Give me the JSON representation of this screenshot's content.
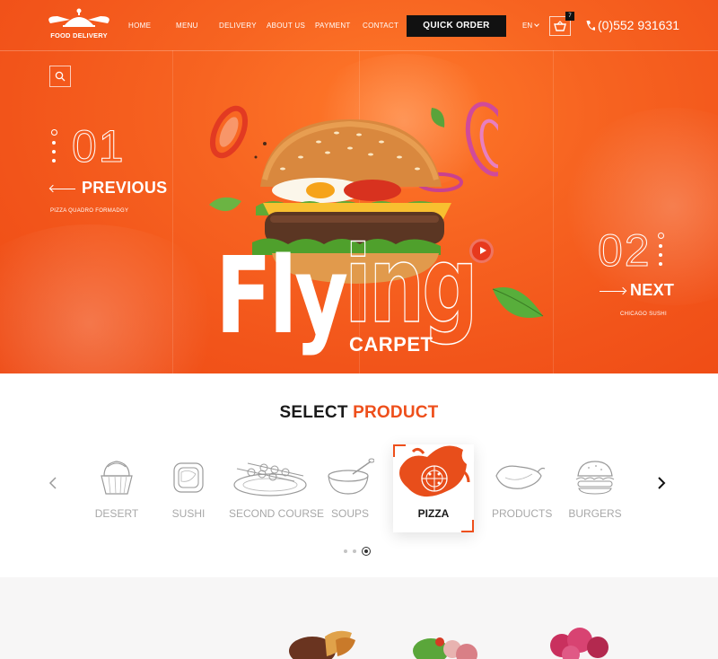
{
  "brand": {
    "name": "FOOD DELIVERY"
  },
  "nav": {
    "items": [
      "HOME",
      "MENU",
      "DELIVERY",
      "ABOUT US",
      "PAYMENT",
      "CONTACT"
    ],
    "quick_order": "QUICK ORDER",
    "language": "EN",
    "cart_count": "7",
    "phone": "(0)552 931631"
  },
  "hero": {
    "prev_number": "01",
    "prev_label": "PREVIOUS",
    "prev_caption": "PIZZA QUADRO FORMADGY",
    "next_number": "02",
    "next_label": "NEXT",
    "next_caption": "CHICAGO SUSHI",
    "headline_solid": "Fly",
    "headline_outline": "ing",
    "headline_sub": "CARPET"
  },
  "products": {
    "title_part1": "SELECT",
    "title_part2": "PRODUCT",
    "items": [
      "DESERT",
      "SUSHI",
      "SECOND COURSE",
      "SOUPS",
      "PIZZA",
      "PRODUCTS",
      "BURGERS"
    ],
    "selected": "PIZZA",
    "pager_total": 3,
    "pager_active": 3
  },
  "colors": {
    "accent": "#ee4f1b",
    "hero_bg": "#f35a1c",
    "dark": "#111111"
  },
  "icons": [
    "logo-cloche-icon",
    "search-icon",
    "cart-icon",
    "phone-icon",
    "play-icon",
    "chevron-left-icon",
    "chevron-right-icon"
  ]
}
